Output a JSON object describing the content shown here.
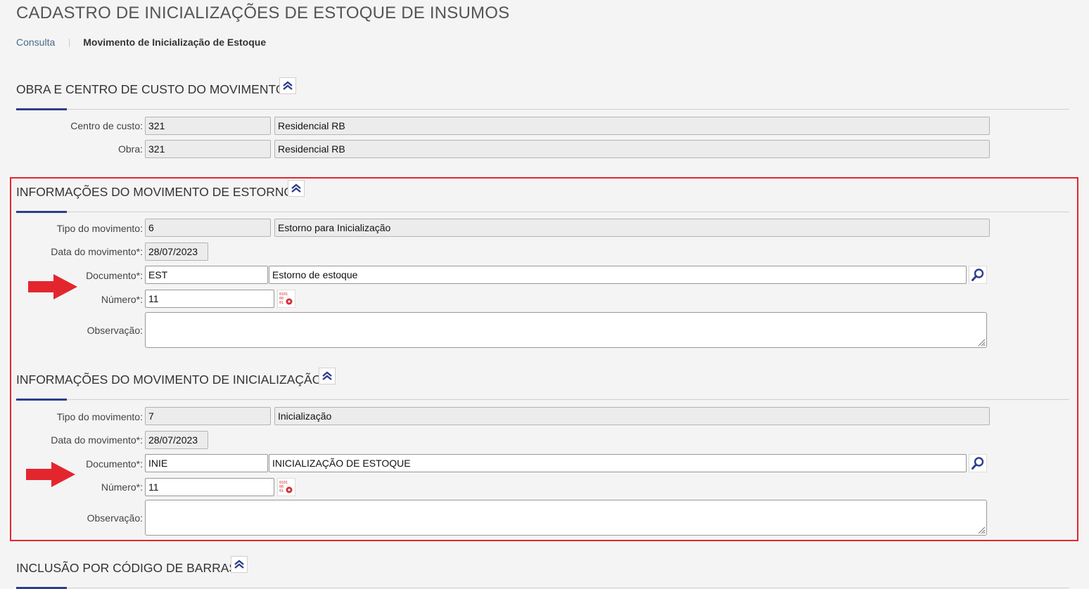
{
  "page": {
    "title": "CADASTRO DE INICIALIZAÇÕES DE ESTOQUE DE INSUMOS"
  },
  "breadcrumb": {
    "link": "Consulta",
    "current": "Movimento de Inicialização de Estoque"
  },
  "section_obra": {
    "title": "OBRA E CENTRO DE CUSTO DO MOVIMENTO",
    "centro_label": "Centro de custo:",
    "centro_code": "321",
    "centro_name": "Residencial RB",
    "obra_label": "Obra:",
    "obra_code": "321",
    "obra_name": "Residencial RB"
  },
  "section_estorno": {
    "title": "INFORMAÇÕES DO MOVIMENTO DE ESTORNO",
    "tipo_label": "Tipo do movimento:",
    "tipo_code": "6",
    "tipo_name": "Estorno para Inicialização",
    "data_label": "Data do movimento*:",
    "data_value": "28/07/2023",
    "doc_label": "Documento*:",
    "doc_code": "EST",
    "doc_name": "Estorno de estoque",
    "numero_label": "Número*:",
    "numero_value": "11",
    "obs_label": "Observação:",
    "obs_value": ""
  },
  "section_inicializacao": {
    "title": "INFORMAÇÕES DO MOVIMENTO DE INICIALIZAÇÃO",
    "tipo_label": "Tipo do movimento:",
    "tipo_code": "7",
    "tipo_name": "Inicialização",
    "data_label": "Data do movimento*:",
    "data_value": "28/07/2023",
    "doc_label": "Documento*:",
    "doc_code": "INIE",
    "doc_name": "INICIALIZAÇÃO DE ESTOQUE",
    "numero_label": "Número*:",
    "numero_value": "11",
    "obs_label": "Observação:",
    "obs_value": ""
  },
  "section_barcode": {
    "title": "INCLUSÃO POR CÓDIGO DE BARRAS"
  },
  "colors": {
    "accent": "#2e3e8c",
    "highlight": "#e3262e",
    "arrow": "#e3262e"
  },
  "icons": [
    "collapse-up-icon",
    "search-icon",
    "number-generator-icon",
    "resize-grip-icon",
    "red-arrow-icon"
  ]
}
